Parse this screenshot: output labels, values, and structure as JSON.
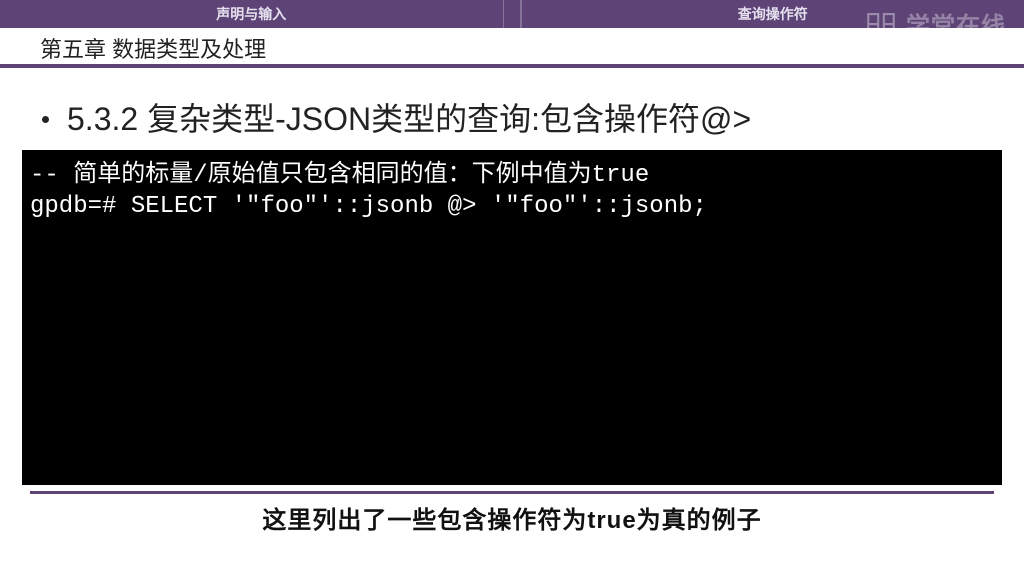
{
  "topbar": {
    "tab_left": "声明与输入",
    "tab_right": "查询操作符"
  },
  "watermark": {
    "text": "学堂在线"
  },
  "chapter": {
    "title": "第五章 数据类型及处理"
  },
  "slide": {
    "bullet": "5.3.2 复杂类型-JSON类型的查询:包含操作符@>",
    "code": "-- 简单的标量/原始值只包含相同的值：下例中值为true\ngpdb=# SELECT '\"foo\"'::jsonb @> '\"foo\"'::jsonb;"
  },
  "caption": "这里列出了一些包含操作符为true为真的例子"
}
